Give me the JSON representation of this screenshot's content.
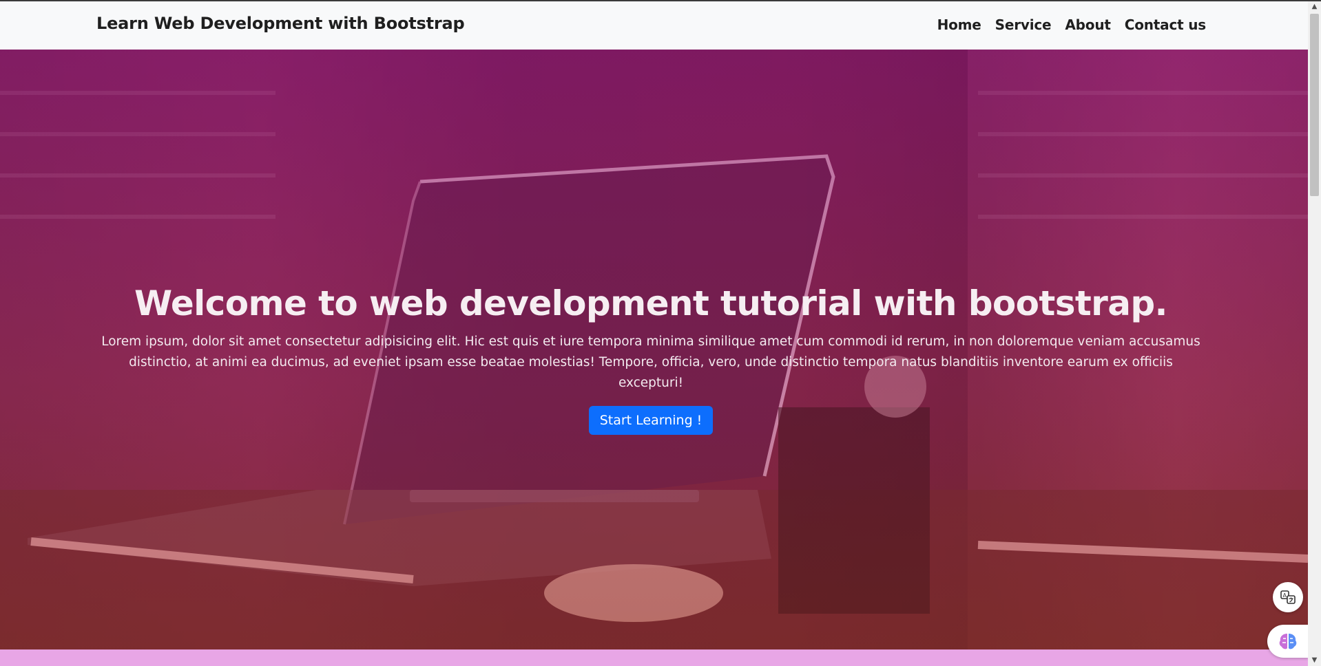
{
  "navbar": {
    "brand": "Learn Web Development with Bootstrap",
    "links": [
      "Home",
      "Service",
      "About",
      "Contact us"
    ]
  },
  "hero": {
    "title": "Welcome to web development tutorial with bootstrap.",
    "text": "Lorem ipsum, dolor sit amet consectetur adipisicing elit. Hic est quis et iure tempora minima similique amet cum commodi id rerum, in non doloremque veniam accusamus distinctio, at animi ea ducimus, ad eveniet ipsam esse beatae molestias! Tempore, officia, vero, unde distinctio tempora natus blanditiis inventore earum ex officiis excepturi!",
    "button": "Start Learning !"
  },
  "colors": {
    "primary": "#0d6efd",
    "overlay": "#8a166e",
    "strip": "#e8a6e6",
    "navbar_bg": "#f8f9fa"
  },
  "icons": {
    "translate": "translate-icon",
    "assistant": "ai-assistant-icon",
    "scroll_up": "scroll-up-arrow-icon",
    "scroll_down": "scroll-down-arrow-icon"
  }
}
